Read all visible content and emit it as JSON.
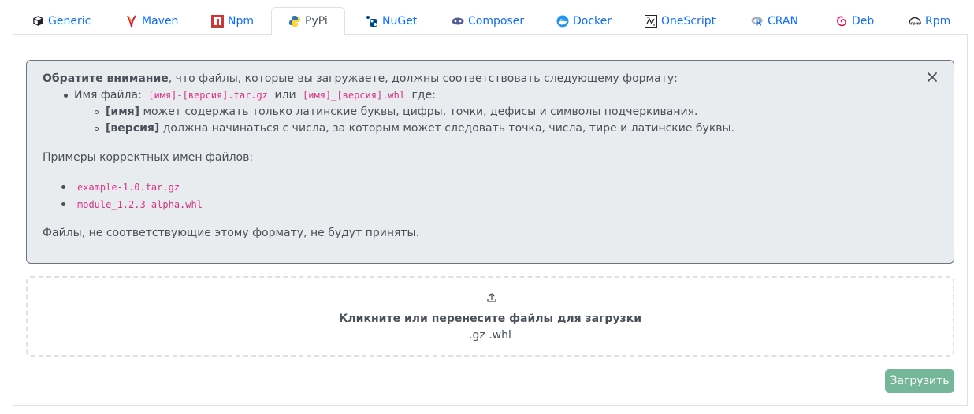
{
  "tabs": [
    {
      "id": "generic",
      "label": "Generic",
      "icon": "box-icon",
      "active": false
    },
    {
      "id": "maven",
      "label": "Maven",
      "icon": "maven-feather-icon",
      "active": false
    },
    {
      "id": "npm",
      "label": "Npm",
      "icon": "npm-icon",
      "active": false
    },
    {
      "id": "pypi",
      "label": "PyPi",
      "icon": "python-icon",
      "active": true
    },
    {
      "id": "nuget",
      "label": "NuGet",
      "icon": "nuget-icon",
      "active": false
    },
    {
      "id": "composer",
      "label": "Composer",
      "icon": "composer-icon",
      "active": false
    },
    {
      "id": "docker",
      "label": "Docker",
      "icon": "docker-icon",
      "active": false
    },
    {
      "id": "onescript",
      "label": "OneScript",
      "icon": "onescript-icon",
      "active": false
    },
    {
      "id": "cran",
      "label": "CRAN",
      "icon": "r-icon",
      "active": false
    },
    {
      "id": "deb",
      "label": "Deb",
      "icon": "debian-swirl-icon",
      "active": false
    },
    {
      "id": "rpm",
      "label": "Rpm",
      "icon": "rpm-icon",
      "active": false
    }
  ],
  "notice": {
    "heading_bold": "Обратите внимание",
    "heading_rest": ", что файлы, которые вы загружаете, должны соответствовать следующему формату:",
    "filename_label": "Имя файла:",
    "format_1": "[имя]-[версия].tar.gz",
    "or_word": "или",
    "format_2": "[имя]_[версия].whl",
    "where_word": "где:",
    "rule_name_bold": "[имя]",
    "rule_name_text": " может содержать только латинские буквы, цифры, точки, дефисы и символы подчеркивания.",
    "rule_version_bold": "[версия]",
    "rule_version_text": " должна начинаться с числа, за которым может следовать точка, числа, тире и латинские буквы.",
    "examples_title": "Примеры корректных имен файлов:",
    "examples": [
      "example-1.0.tar.gz",
      "module_1.2.3-alpha.whl"
    ],
    "footer": "Файлы, не соответствующие этому формату, не будут приняты."
  },
  "dropzone": {
    "message": "Кликните или перенесите файлы для загрузки",
    "extensions": ".gz .whl"
  },
  "upload_button": {
    "label": "Загрузить",
    "color": "#75b798"
  },
  "colors": {
    "link": "#0d6efd",
    "alert_bg": "#e9ecef",
    "code": "#d63384"
  }
}
